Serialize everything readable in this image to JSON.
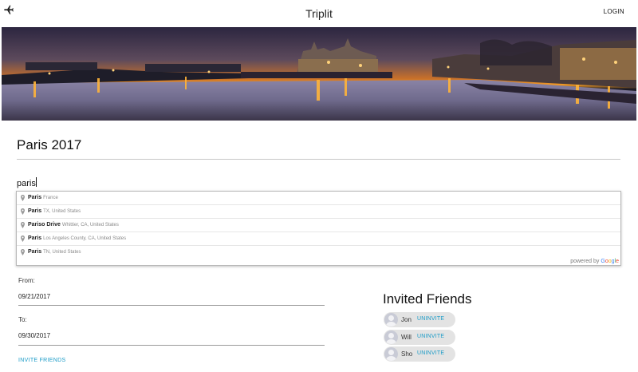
{
  "header": {
    "brand_icon": "airplane-icon",
    "title": "Triplit",
    "login_label": "LOGIN"
  },
  "banner": {
    "description_icon": "paris-night-skyline-image",
    "colors": {
      "sky_top": "#2f2744",
      "horizon": "#f08a1e",
      "water": "#7a7696"
    }
  },
  "trip": {
    "title": "Paris 2017"
  },
  "search": {
    "value": "paris"
  },
  "autocomplete": {
    "items": [
      {
        "main": "Paris",
        "secondary": "France"
      },
      {
        "main": "Paris",
        "secondary": "TX, United States"
      },
      {
        "main": "Pariso Drive",
        "secondary": "Whittier, CA, United States"
      },
      {
        "main": "Paris",
        "secondary": "Los Angeles County, CA, United States"
      },
      {
        "main": "Paris",
        "secondary": "TN, United States"
      }
    ],
    "powered_by": "powered by",
    "logo_letters": [
      "G",
      "o",
      "o",
      "g",
      "l",
      "e"
    ]
  },
  "dates": {
    "from_label": "From:",
    "from_value": "09/21/2017",
    "to_label": "To:",
    "to_value": "09/30/2017"
  },
  "invite_label": "INVITE FRIENDS",
  "friends": {
    "title": "Invited Friends",
    "uninvite_label": "UNINVITE",
    "list": [
      {
        "name": "Jon"
      },
      {
        "name": "Will"
      },
      {
        "name": "Sho"
      }
    ]
  },
  "colors": {
    "accent": "#1a9bc7",
    "divider": "#c7c7c7"
  }
}
